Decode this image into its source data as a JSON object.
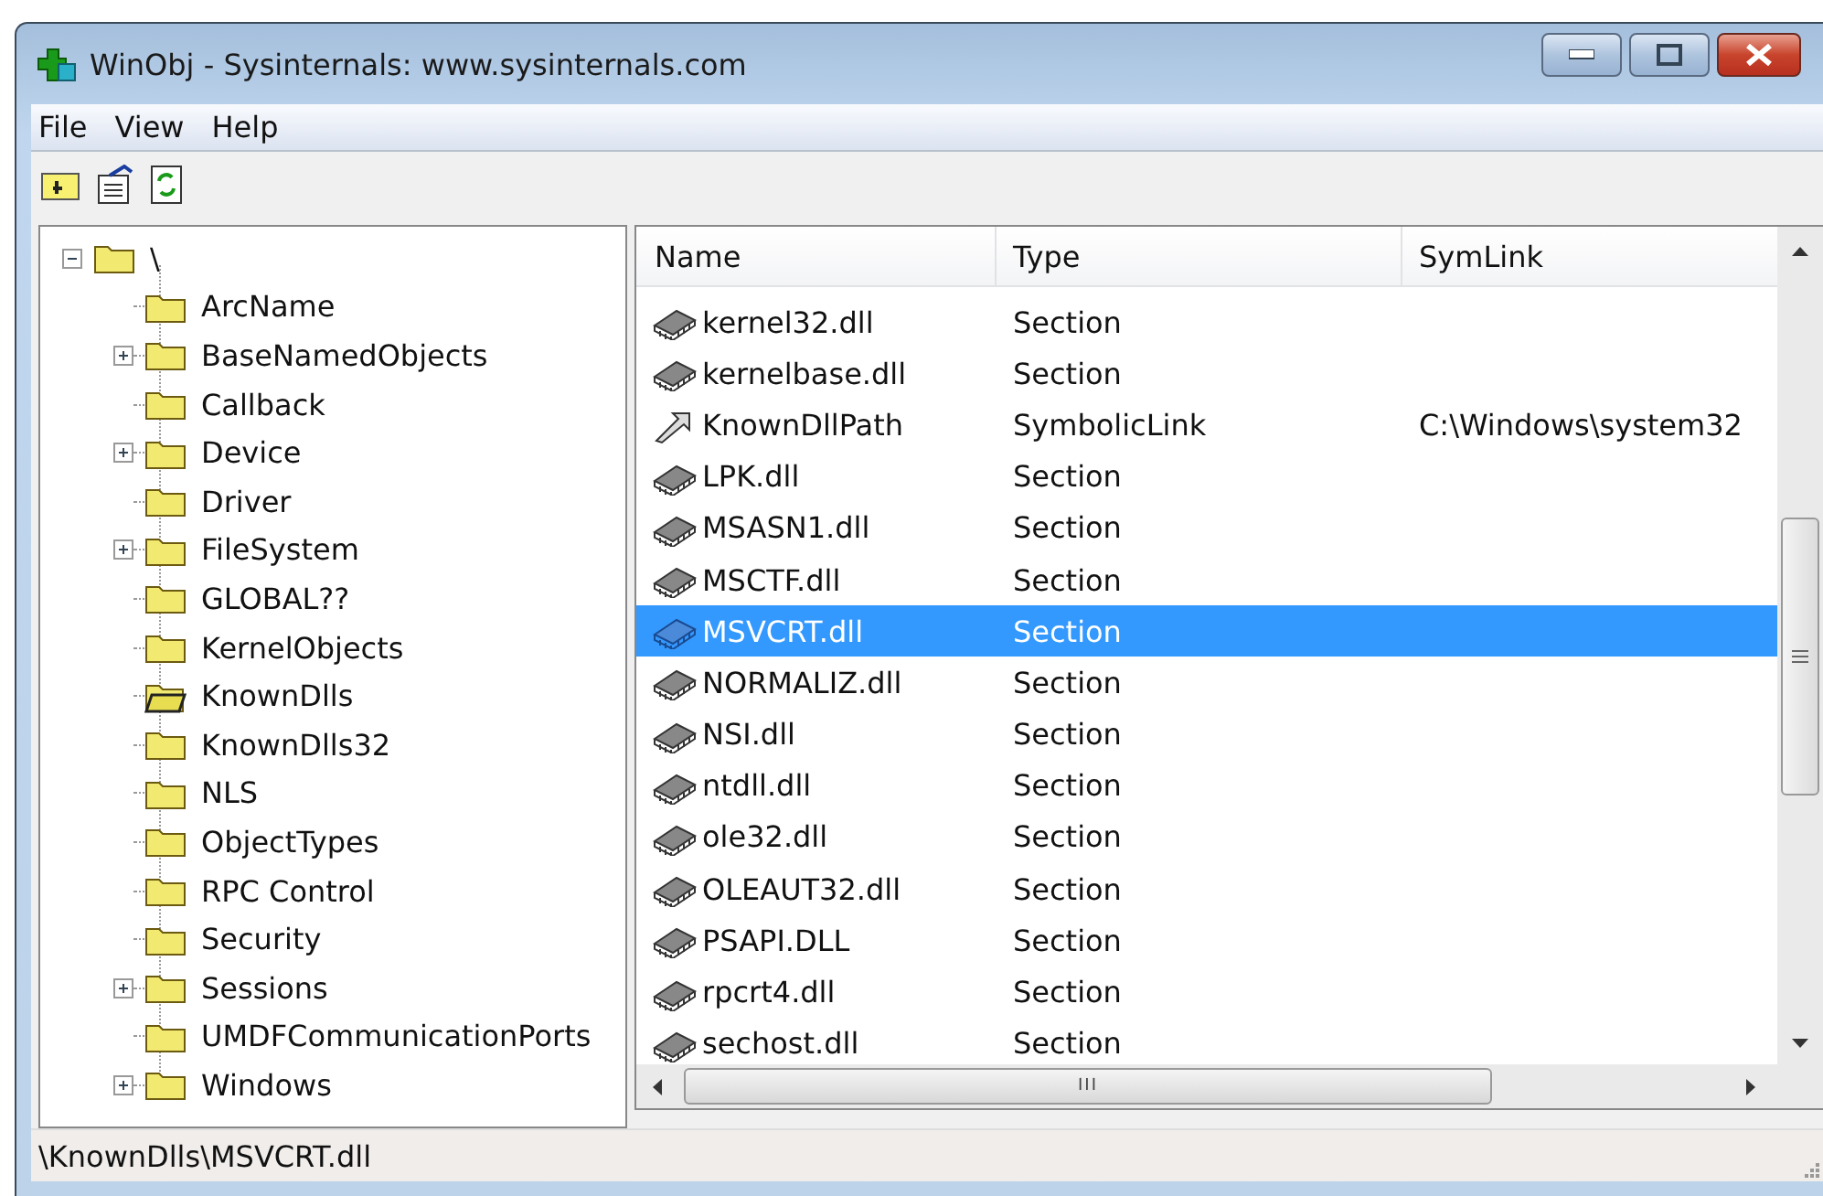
{
  "window": {
    "title": "WinObj - Sysinternals: www.sysinternals.com"
  },
  "menu": [
    "File",
    "View",
    "Help"
  ],
  "tree": {
    "label": "\\",
    "expanded": true,
    "children": [
      {
        "label": "ArcName",
        "expandable": false,
        "open": false
      },
      {
        "label": "BaseNamedObjects",
        "expandable": true,
        "open": false
      },
      {
        "label": "Callback",
        "expandable": false,
        "open": false
      },
      {
        "label": "Device",
        "expandable": true,
        "open": false
      },
      {
        "label": "Driver",
        "expandable": false,
        "open": false
      },
      {
        "label": "FileSystem",
        "expandable": true,
        "open": false
      },
      {
        "label": "GLOBAL??",
        "expandable": false,
        "open": false
      },
      {
        "label": "KernelObjects",
        "expandable": false,
        "open": false
      },
      {
        "label": "KnownDlls",
        "expandable": false,
        "open": true
      },
      {
        "label": "KnownDlls32",
        "expandable": false,
        "open": false
      },
      {
        "label": "NLS",
        "expandable": false,
        "open": false
      },
      {
        "label": "ObjectTypes",
        "expandable": false,
        "open": false
      },
      {
        "label": "RPC Control",
        "expandable": false,
        "open": false
      },
      {
        "label": "Security",
        "expandable": false,
        "open": false
      },
      {
        "label": "Sessions",
        "expandable": true,
        "open": false
      },
      {
        "label": "UMDFCommunicationPorts",
        "expandable": false,
        "open": false
      },
      {
        "label": "Windows",
        "expandable": true,
        "open": false
      }
    ]
  },
  "table": {
    "columns": [
      "Name",
      "Type",
      "SymLink"
    ],
    "rows": [
      {
        "kind": "section",
        "name": "kernel32.dll",
        "type": "Section",
        "selected": false
      },
      {
        "kind": "section",
        "name": "kernelbase.dll",
        "type": "Section",
        "selected": false
      },
      {
        "kind": "symlink",
        "name": "KnownDllPath",
        "type": "SymbolicLink",
        "symlink": "C:\\Windows\\system32",
        "selected": false
      },
      {
        "kind": "section",
        "name": "LPK.dll",
        "type": "Section",
        "selected": false
      },
      {
        "kind": "section",
        "name": "MSASN1.dll",
        "type": "Section",
        "selected": false
      },
      {
        "kind": "section",
        "name": "MSCTF.dll",
        "type": "Section",
        "selected": false
      },
      {
        "kind": "section",
        "name": "MSVCRT.dll",
        "type": "Section",
        "selected": true
      },
      {
        "kind": "section",
        "name": "NORMALIZ.dll",
        "type": "Section",
        "selected": false
      },
      {
        "kind": "section",
        "name": "NSI.dll",
        "type": "Section",
        "selected": false
      },
      {
        "kind": "section",
        "name": "ntdll.dll",
        "type": "Section",
        "selected": false
      },
      {
        "kind": "section",
        "name": "ole32.dll",
        "type": "Section",
        "selected": false
      },
      {
        "kind": "section",
        "name": "OLEAUT32.dll",
        "type": "Section",
        "selected": false
      },
      {
        "kind": "section",
        "name": "PSAPI.DLL",
        "type": "Section",
        "selected": false
      },
      {
        "kind": "section",
        "name": "rpcrt4.dll",
        "type": "Section",
        "selected": false
      },
      {
        "kind": "section",
        "name": "sechost.dll",
        "type": "Section",
        "selected": false
      }
    ]
  },
  "horizontal_scrollbar": {
    "grip": "III"
  },
  "status_bar": {
    "path": "\\KnownDlls\\MSVCRT.dll"
  }
}
